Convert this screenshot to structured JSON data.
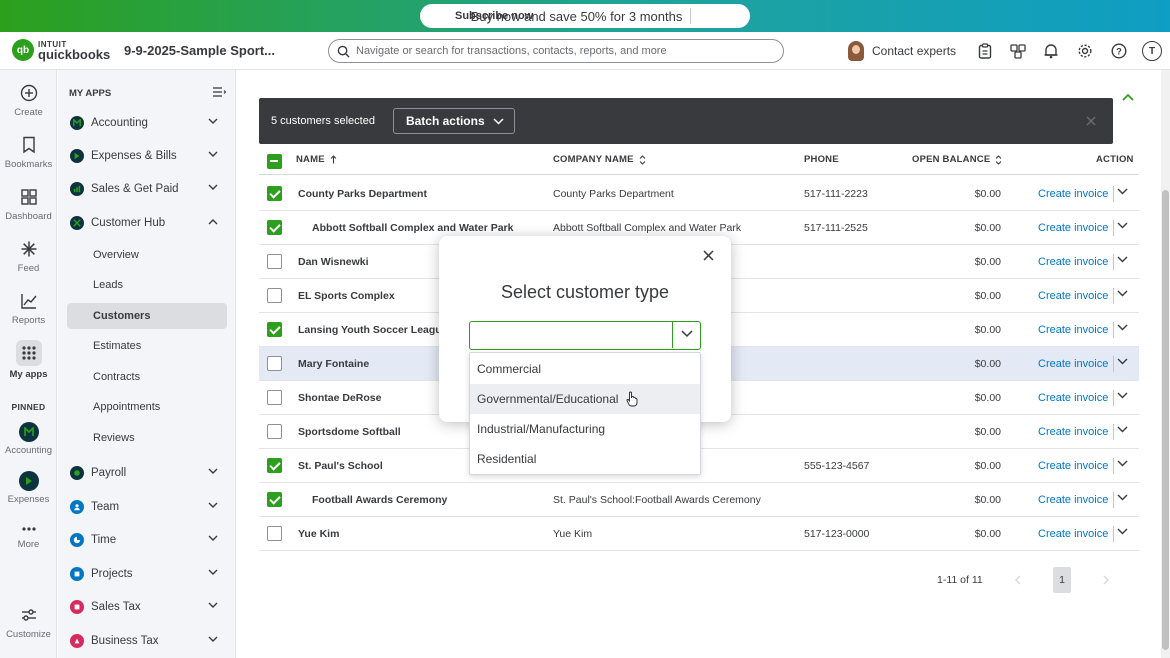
{
  "promo": {
    "text": "Buy now and save 50% for 3 months",
    "cta": "Subscribe now"
  },
  "header": {
    "logo_top": "INTUIT",
    "logo_bottom": "quickbooks",
    "company_name": "9-9-2025-Sample Sport...",
    "search_placeholder": "Navigate or search for transactions, contacts, reports, and more",
    "contact_experts": "Contact experts",
    "avatar_initial": "T"
  },
  "rail": {
    "items": [
      {
        "label": "Create",
        "icon": "plus-circle-icon"
      },
      {
        "label": "Bookmarks",
        "icon": "bookmark-icon"
      },
      {
        "label": "Dashboard",
        "icon": "dashboard-icon"
      },
      {
        "label": "Feed",
        "icon": "feed-icon"
      },
      {
        "label": "Reports",
        "icon": "chart-icon"
      },
      {
        "label": "My apps",
        "icon": "grid-icon"
      }
    ],
    "pinned_label": "PINNED",
    "pinned": [
      {
        "label": "Accounting"
      },
      {
        "label": "Expenses"
      }
    ],
    "more": "More",
    "customize": "Customize"
  },
  "sidebar": {
    "title": "MY APPS",
    "sections": [
      {
        "label": "Accounting",
        "expanded": false
      },
      {
        "label": "Expenses & Bills",
        "expanded": false
      },
      {
        "label": "Sales & Get Paid",
        "expanded": false
      },
      {
        "label": "Customer Hub",
        "expanded": true
      },
      {
        "label": "Payroll",
        "expanded": false
      },
      {
        "label": "Team",
        "expanded": false
      },
      {
        "label": "Time",
        "expanded": false
      },
      {
        "label": "Projects",
        "expanded": false
      },
      {
        "label": "Sales Tax",
        "expanded": false
      },
      {
        "label": "Business Tax",
        "expanded": false
      }
    ],
    "customer_hub_items": [
      {
        "label": "Overview",
        "active": false
      },
      {
        "label": "Leads",
        "active": false
      },
      {
        "label": "Customers",
        "active": true
      },
      {
        "label": "Estimates",
        "active": false
      },
      {
        "label": "Contracts",
        "active": false
      },
      {
        "label": "Appointments",
        "active": false
      },
      {
        "label": "Reviews",
        "active": false
      }
    ]
  },
  "batch": {
    "selected_text": "5 customers selected",
    "button_label": "Batch actions"
  },
  "table": {
    "columns": {
      "name": "NAME",
      "company": "COMPANY NAME",
      "phone": "PHONE",
      "balance": "OPEN BALANCE",
      "action": "ACTION"
    },
    "rows": [
      {
        "name": "County Parks Department",
        "company": "County Parks Department",
        "phone": "517-111-2223",
        "balance": "$0.00",
        "action": "Create invoice",
        "checked": true,
        "child": false
      },
      {
        "name": "Abbott Softball Complex and Water Park",
        "company": "Abbott Softball Complex and Water Park",
        "phone": "517-111-2525",
        "balance": "$0.00",
        "action": "Create invoice",
        "checked": true,
        "child": true
      },
      {
        "name": "Dan Wisnewki",
        "company": "",
        "phone": "",
        "balance": "$0.00",
        "action": "Create invoice",
        "checked": false,
        "child": false
      },
      {
        "name": "EL Sports Complex",
        "company": "",
        "phone": "",
        "balance": "$0.00",
        "action": "Create invoice",
        "checked": false,
        "child": false
      },
      {
        "name": "Lansing Youth Soccer League",
        "company": "",
        "phone": "",
        "balance": "$0.00",
        "action": "Create invoice",
        "checked": true,
        "child": false
      },
      {
        "name": "Mary Fontaine",
        "company": "",
        "phone": "",
        "balance": "$0.00",
        "action": "Create invoice",
        "checked": false,
        "child": false,
        "highlight": true
      },
      {
        "name": "Shontae DeRose",
        "company": "",
        "phone": "",
        "balance": "$0.00",
        "action": "Create invoice",
        "checked": false,
        "child": false
      },
      {
        "name": "Sportsdome Softball",
        "company": "",
        "phone": "",
        "balance": "$0.00",
        "action": "Create invoice",
        "checked": false,
        "child": false
      },
      {
        "name": "St. Paul's School",
        "company": "",
        "phone": "555-123-4567",
        "balance": "$0.00",
        "action": "Create invoice",
        "checked": true,
        "child": false
      },
      {
        "name": "Football Awards Ceremony",
        "company": "St. Paul's School:Football Awards Ceremony",
        "phone": "",
        "balance": "$0.00",
        "action": "Create invoice",
        "checked": true,
        "child": true
      },
      {
        "name": "Yue Kim",
        "company": "Yue Kim",
        "phone": "517-123-0000",
        "balance": "$0.00",
        "action": "Create invoice",
        "checked": false,
        "child": false
      }
    ]
  },
  "pagination": {
    "range": "1-11 of 11",
    "current_page": "1"
  },
  "modal": {
    "title": "Select customer type",
    "selected_value": "",
    "options": [
      {
        "label": "Commercial",
        "hover": false
      },
      {
        "label": "Governmental/Educational",
        "hover": true
      },
      {
        "label": "Industrial/Manufacturing",
        "hover": false
      },
      {
        "label": "Residential",
        "hover": false
      }
    ]
  },
  "colors": {
    "brand_green": "#2ca01c",
    "link_blue": "#0077c5",
    "dark_bar": "#393a3d",
    "row_highlight": "#e3e9f5"
  }
}
